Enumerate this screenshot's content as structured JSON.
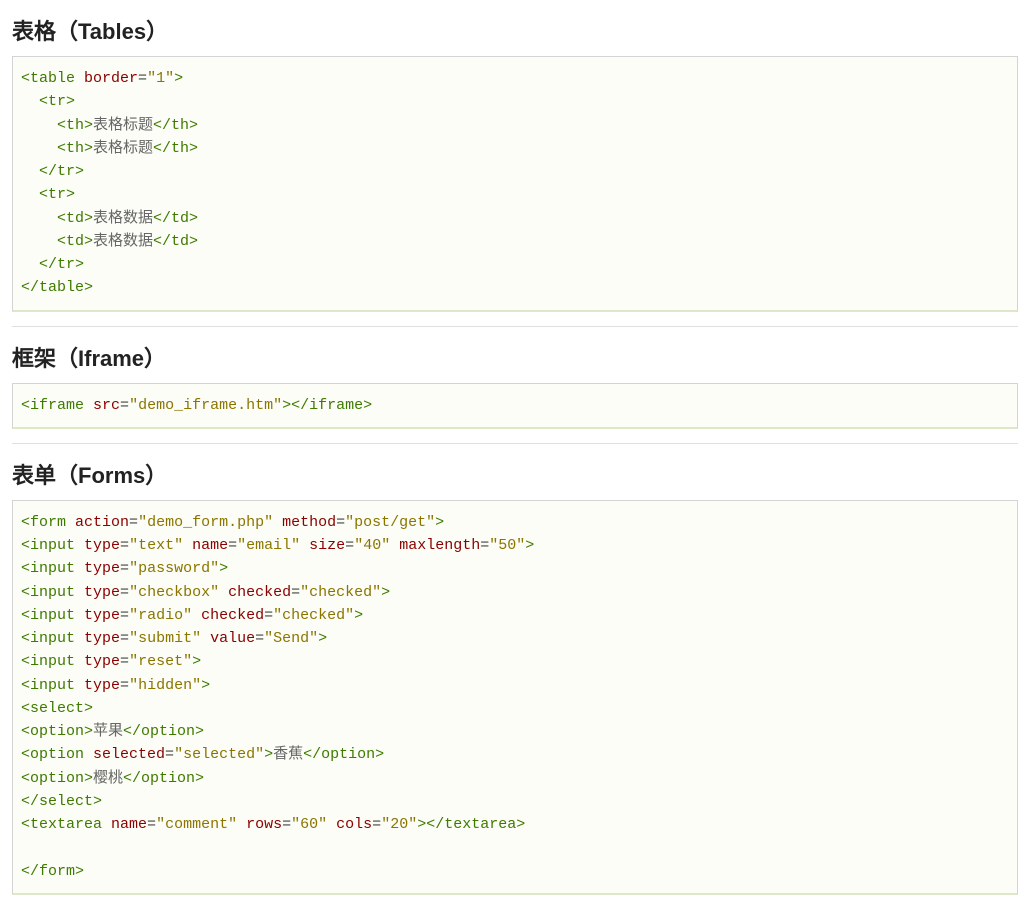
{
  "sections": {
    "tables": {
      "heading": "表格（Tables）",
      "code_html": "<span class=\"g\">&lt;table</span> <span class=\"m\">border</span>=<span class=\"o\">\"1\"</span><span class=\"g\">&gt;</span>\n  <span class=\"g\">&lt;tr&gt;</span>\n    <span class=\"g\">&lt;th&gt;</span><span class=\"gr\">表格标题</span><span class=\"g\">&lt;/th&gt;</span>\n    <span class=\"g\">&lt;th&gt;</span><span class=\"gr\">表格标题</span><span class=\"g\">&lt;/th&gt;</span>\n  <span class=\"g\">&lt;/tr&gt;</span>\n  <span class=\"g\">&lt;tr&gt;</span>\n    <span class=\"g\">&lt;td&gt;</span><span class=\"gr\">表格数据</span><span class=\"g\">&lt;/td&gt;</span>\n    <span class=\"g\">&lt;td&gt;</span><span class=\"gr\">表格数据</span><span class=\"g\">&lt;/td&gt;</span>\n  <span class=\"g\">&lt;/tr&gt;</span>\n<span class=\"g\">&lt;/table&gt;</span>"
    },
    "iframe": {
      "heading": "框架（Iframe）",
      "code_html": "<span class=\"g\">&lt;iframe</span> <span class=\"m\">src</span>=<span class=\"o\">\"demo_iframe.htm\"</span><span class=\"g\">&gt;&lt;/iframe&gt;</span>"
    },
    "forms": {
      "heading": "表单（Forms）",
      "code_html": "<span class=\"g\">&lt;form</span> <span class=\"m\">action</span>=<span class=\"o\">\"demo_form.php\"</span> <span class=\"m\">method</span>=<span class=\"o\">\"post/get\"</span><span class=\"g\">&gt;</span>\n<span class=\"g\">&lt;input</span> <span class=\"m\">type</span>=<span class=\"o\">\"text\"</span> <span class=\"m\">name</span>=<span class=\"o\">\"email\"</span> <span class=\"m\">size</span>=<span class=\"o\">\"40\"</span> <span class=\"m\">maxlength</span>=<span class=\"o\">\"50\"</span><span class=\"g\">&gt;</span>\n<span class=\"g\">&lt;input</span> <span class=\"m\">type</span>=<span class=\"o\">\"password\"</span><span class=\"g\">&gt;</span>\n<span class=\"g\">&lt;input</span> <span class=\"m\">type</span>=<span class=\"o\">\"checkbox\"</span> <span class=\"m\">checked</span>=<span class=\"o\">\"checked\"</span><span class=\"g\">&gt;</span>\n<span class=\"g\">&lt;input</span> <span class=\"m\">type</span>=<span class=\"o\">\"radio\"</span> <span class=\"m\">checked</span>=<span class=\"o\">\"checked\"</span><span class=\"g\">&gt;</span>\n<span class=\"g\">&lt;input</span> <span class=\"m\">type</span>=<span class=\"o\">\"submit\"</span> <span class=\"m\">value</span>=<span class=\"o\">\"Send\"</span><span class=\"g\">&gt;</span>\n<span class=\"g\">&lt;input</span> <span class=\"m\">type</span>=<span class=\"o\">\"reset\"</span><span class=\"g\">&gt;</span>\n<span class=\"g\">&lt;input</span> <span class=\"m\">type</span>=<span class=\"o\">\"hidden\"</span><span class=\"g\">&gt;</span>\n<span class=\"g\">&lt;select&gt;</span>\n<span class=\"g\">&lt;option&gt;</span><span class=\"gr\">苹果</span><span class=\"g\">&lt;/option&gt;</span>\n<span class=\"g\">&lt;option</span> <span class=\"m\">selected</span>=<span class=\"o\">\"selected\"</span><span class=\"g\">&gt;</span><span class=\"gr\">香蕉</span><span class=\"g\">&lt;/option&gt;</span>\n<span class=\"g\">&lt;option&gt;</span><span class=\"gr\">樱桃</span><span class=\"g\">&lt;/option&gt;</span>\n<span class=\"g\">&lt;/select&gt;</span>\n<span class=\"g\">&lt;textarea</span> <span class=\"m\">name</span>=<span class=\"o\">\"comment\"</span> <span class=\"m\">rows</span>=<span class=\"o\">\"60\"</span> <span class=\"m\">cols</span>=<span class=\"o\">\"20\"</span><span class=\"g\">&gt;&lt;/textarea&gt;</span>\n\n<span class=\"g\">&lt;/form&gt;</span>"
    }
  }
}
